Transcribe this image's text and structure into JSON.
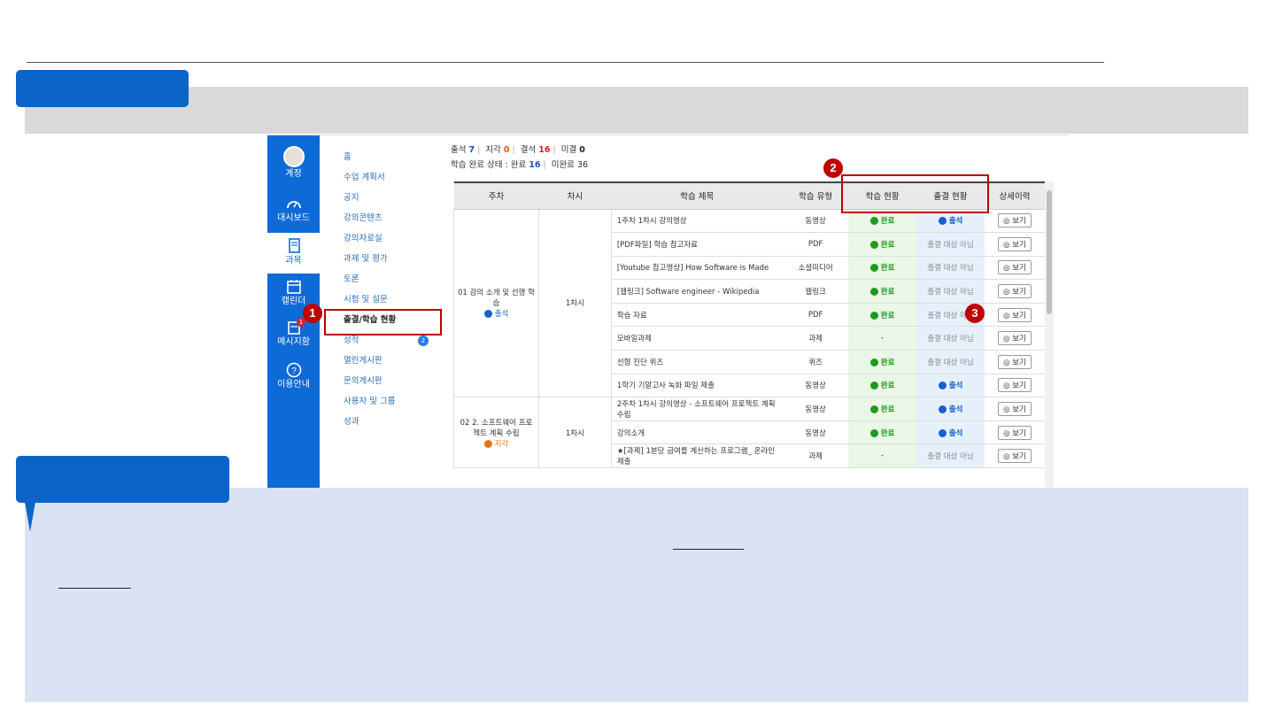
{
  "colors": {
    "accent": "#0d64c8",
    "annotation": "#c00000",
    "done": "#1f9a1f",
    "attend": "#1a5fd0",
    "late": "#e6731f"
  },
  "global_nav": [
    {
      "label": "계정",
      "icon": "avatar"
    },
    {
      "label": "대시보드",
      "icon": "dashboard-icon"
    },
    {
      "label": "과목",
      "icon": "book-icon",
      "active": true
    },
    {
      "label": "캘린더",
      "icon": "calendar-icon"
    },
    {
      "label": "메시지함",
      "icon": "inbox-icon",
      "badge": "1"
    },
    {
      "label": "이용안내",
      "icon": "help-icon"
    }
  ],
  "course_nav": [
    {
      "label": "홈"
    },
    {
      "label": "수업 계획서"
    },
    {
      "label": "공지"
    },
    {
      "label": "강의콘텐츠"
    },
    {
      "label": "강의자료실"
    },
    {
      "label": "과제 및 평가"
    },
    {
      "label": "토론"
    },
    {
      "label": "시험 및 설문"
    },
    {
      "label": "출결/학습 현황"
    },
    {
      "label": "성적",
      "badge": "2"
    },
    {
      "label": "열린게시판"
    },
    {
      "label": "문의게시판"
    },
    {
      "label": "사용자 및 그룹"
    },
    {
      "label": "성과"
    }
  ],
  "summary": {
    "attend_label": "출석",
    "attend": "7",
    "late_label": "지각",
    "late": "0",
    "absent_label": "결석",
    "absent": "16",
    "undecided_label": "미결",
    "undecided": "0",
    "complete_prefix": "학습 완료 상태 : 완료",
    "complete": "16",
    "incomplete_prefix": "미완료",
    "incomplete": "36"
  },
  "table": {
    "headers": [
      "주차",
      "차시",
      "학습 제목",
      "학습 유형",
      "학습 현황",
      "출결 현황",
      "상세이력"
    ],
    "groups": [
      {
        "week": "01 강의 소개 및 선행 학습",
        "week_status": "출석",
        "session": "1차시",
        "rows": [
          {
            "title": "1주차 1차시 강의영상",
            "type": "동영상",
            "progress": "완료",
            "attendance": "출석"
          },
          {
            "title": "[PDF파일] 학습 참고자료",
            "type": "PDF",
            "progress": "완료",
            "attendance": "출결 대상 아님"
          },
          {
            "title": "[Youtube 참고영상] How Software is Made",
            "type": "소셜미디어",
            "progress": "완료",
            "attendance": "출결 대상 아님"
          },
          {
            "title": "[웹링크] Software engineer - Wikipedia",
            "type": "웹링크",
            "progress": "완료",
            "attendance": "출결 대상 아님"
          },
          {
            "title": "학습 자료",
            "type": "PDF",
            "progress": "완료",
            "attendance": "출결 대상 아님"
          },
          {
            "title": "모바일과제",
            "type": "과제",
            "progress": "-",
            "attendance": "출결 대상 아님"
          },
          {
            "title": "선형 진단 퀴즈",
            "type": "퀴즈",
            "progress": "완료",
            "attendance": "출결 대상 아님"
          },
          {
            "title": "1학기 기말고사 녹화 파일 제출",
            "type": "동영상",
            "progress": "완료",
            "attendance": "출석"
          }
        ]
      },
      {
        "week": "02 2. 소프트웨어 프로젝트 계획 수립",
        "week_status": "지각",
        "session": "1차시",
        "rows": [
          {
            "title": "2주차 1차시 강의영상 - 소프트웨어 프로젝트 계획 수립",
            "type": "동영상",
            "progress": "완료",
            "attendance": "출석"
          },
          {
            "title": "강의소개",
            "type": "동영상",
            "progress": "완료",
            "attendance": "출석"
          },
          {
            "title": "★[과제] 1분당 급여를 계산하는 프로그램_ 온라인 제출",
            "type": "과제",
            "progress": "-",
            "attendance": "출결 대상 아님"
          }
        ]
      }
    ],
    "view_label": "보기"
  },
  "annotations": [
    "1",
    "2",
    "3"
  ]
}
